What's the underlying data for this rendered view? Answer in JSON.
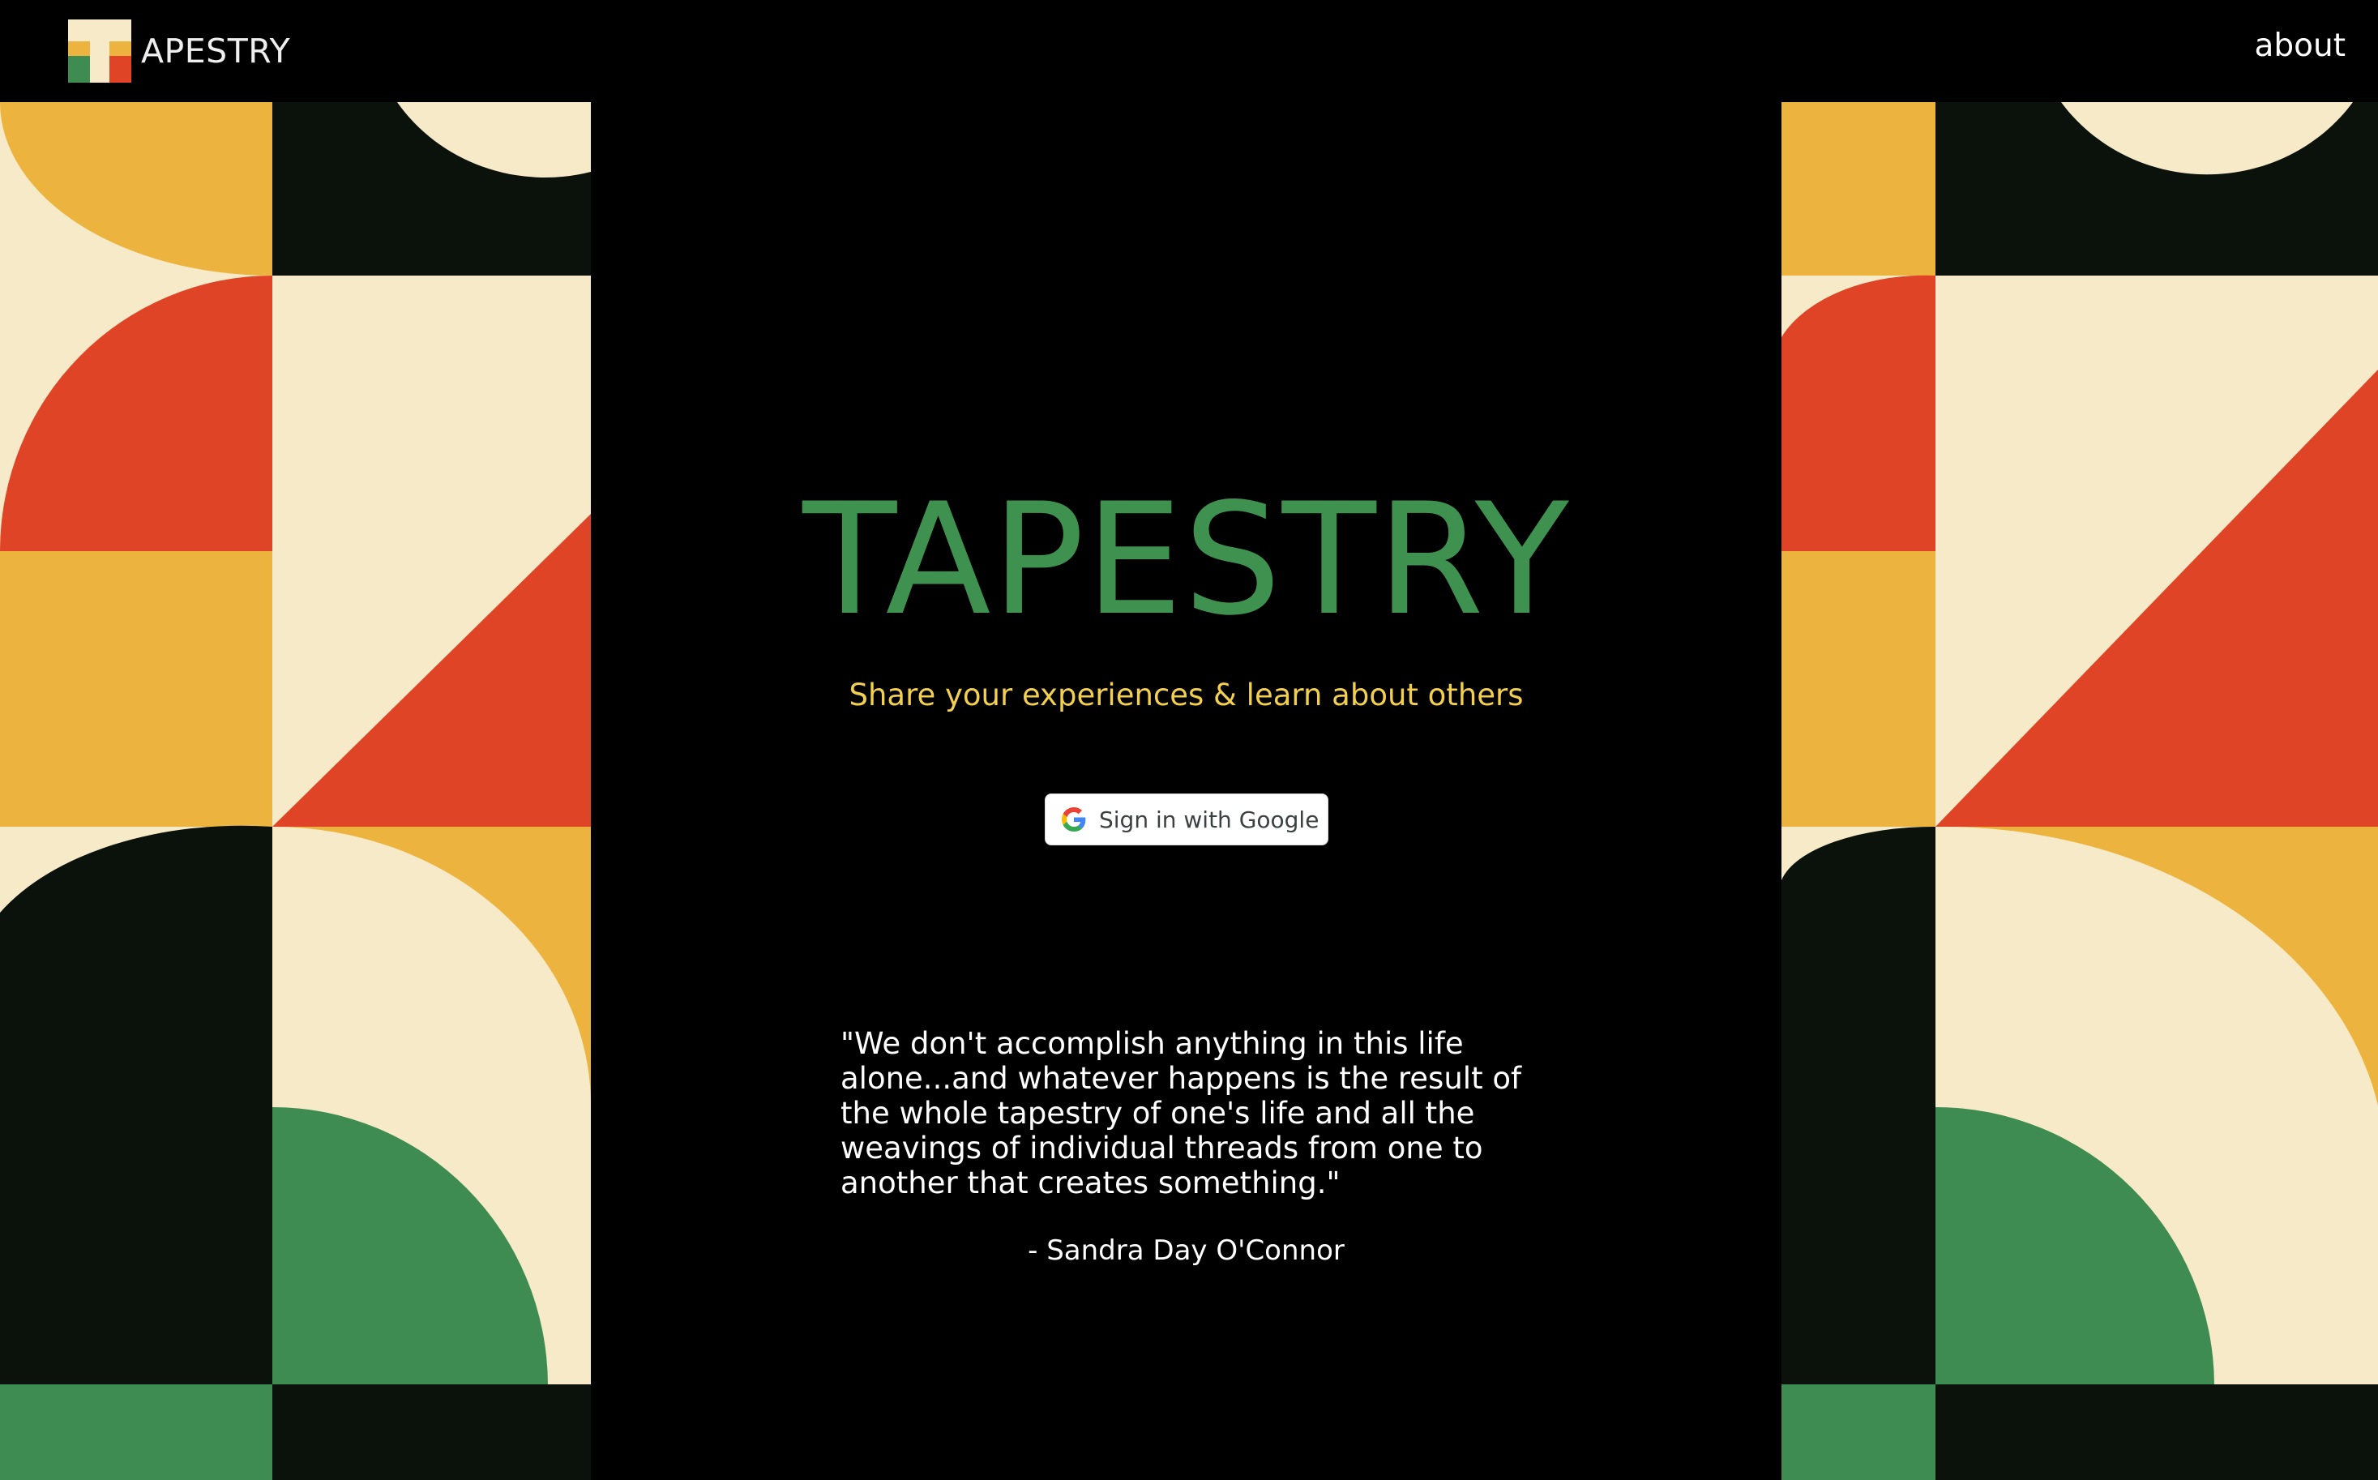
{
  "header": {
    "logo_text": "APESTRY",
    "about_label": "about"
  },
  "hero": {
    "title": "TAPESTRY",
    "tagline": "Share your experiences & learn about others"
  },
  "auth": {
    "google_button_label": "Sign in with Google",
    "google_icon": "google-g-icon"
  },
  "quote": {
    "text": "\"We don't accomplish anything in this life alone...and whatever happens is the result of the whole tapestry of one's life and all the weavings of individual threads from one to another that creates something.\"",
    "author": "- Sandra Day O'Connor"
  },
  "colors": {
    "background": "#000000",
    "brand_green": "#3f9150",
    "tagline_yellow": "#f2cf4f",
    "pattern_cream": "#f7eac9",
    "pattern_mustard": "#ecb43e",
    "pattern_red": "#de4425",
    "pattern_dark": "#0a120b",
    "pattern_green": "#3f8c52"
  }
}
